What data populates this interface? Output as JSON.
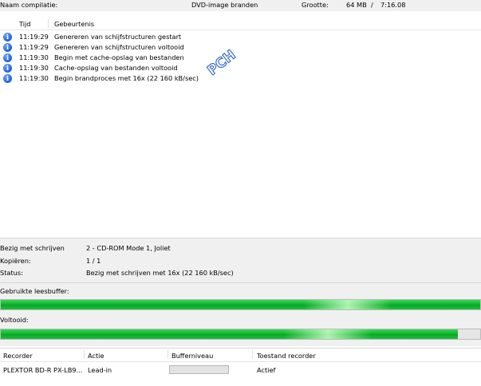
{
  "top": {
    "compilation_label": "Naam compilatie:",
    "task": "DVD-image branden",
    "size_label": "Grootte:",
    "size_value": "64 MB",
    "separator": "/",
    "duration": "7:16.08"
  },
  "log": {
    "col_time": "Tijd",
    "col_event": "Gebeurtenis",
    "rows": [
      {
        "icon": "info-icon",
        "time": "11:19:29",
        "event": "Genereren van schijfstructuren gestart"
      },
      {
        "icon": "info-icon",
        "time": "11:19:29",
        "event": "Genereren van schijfstructuren voltooid"
      },
      {
        "icon": "info-icon",
        "time": "11:19:30",
        "event": "Begin met cache-opslag van bestanden"
      },
      {
        "icon": "info-icon",
        "time": "11:19:30",
        "event": "Cache-opslag van bestanden voltooid"
      },
      {
        "icon": "info-icon",
        "time": "11:19:30",
        "event": "Begin brandproces met 16x (22 160 kB/sec)"
      }
    ]
  },
  "watermark": "PCH",
  "status": {
    "writing_label": "Bezig met schrijven",
    "writing_value": "2 - CD-ROM Mode 1, Joliet",
    "copies_label": "Kopiëren:",
    "copies_value": "1 / 1",
    "status_label": "Status:",
    "status_value": "Bezig met schrijven met 16x (22 160 kB/sec)",
    "buffer_label": "Gebruikte leesbuffer:",
    "buffer_fraction": 1.0,
    "done_label": "Voltooid:",
    "done_fraction": 0.953
  },
  "recorders": {
    "headers": [
      "Recorder",
      "Actie",
      "Bufferniveau",
      "Toestand recorder"
    ],
    "rows": [
      {
        "recorder": "PLEXTOR BD-R  PX-LB9...",
        "action": "Lead-in",
        "buffer_fraction": 0,
        "state": "Actief"
      }
    ]
  },
  "colors": {
    "progress_green": "#10b42c",
    "info_blue": "#1f5fd0",
    "watermark_blue": "#2a62c9"
  }
}
